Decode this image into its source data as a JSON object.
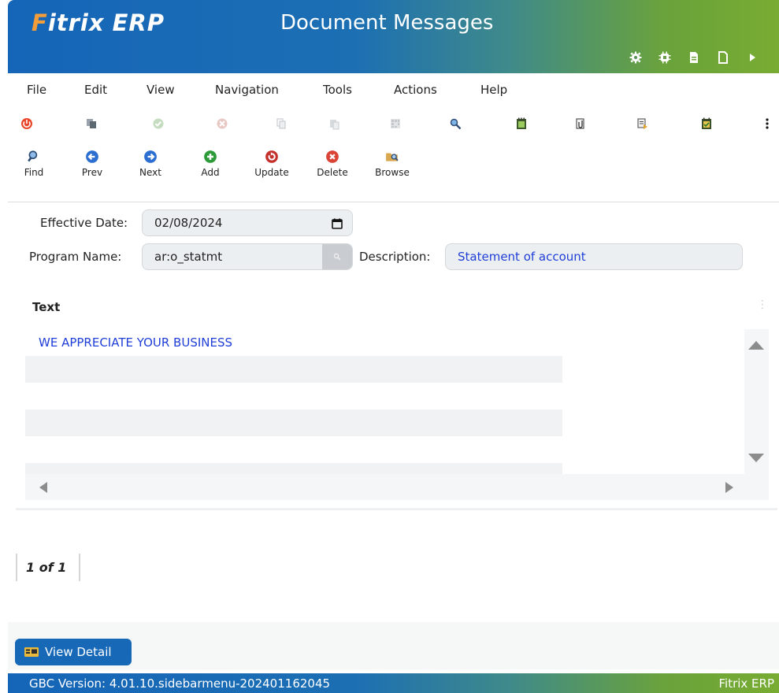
{
  "header": {
    "logo_accent": "F",
    "logo_rest": "itrix",
    "logo_erp": "ERP",
    "title": "Document Messages",
    "icons": [
      "gear-icon",
      "chip-icon",
      "document-icon",
      "new-document-icon",
      "play-icon"
    ]
  },
  "menu": [
    "File",
    "Edit",
    "View",
    "Navigation",
    "Tools",
    "Actions",
    "Help"
  ],
  "icon_toolbar": [
    "power-icon",
    "copy-icon",
    "accept-icon",
    "cancel-icon",
    "duplicate-icon",
    "paste-icon",
    "grid-icon",
    "zoom-icon",
    "notes-icon",
    "attach-icon",
    "report-icon",
    "checklist-icon",
    "more-icon"
  ],
  "actions": {
    "find": "Find",
    "prev": "Prev",
    "next": "Next",
    "add": "Add",
    "update": "Update",
    "delete": "Delete",
    "browse": "Browse"
  },
  "form": {
    "effective_date_label": "Effective Date:",
    "effective_date": "02/08/2024",
    "program_name_label": "Program Name:",
    "program_name": "ar:o_statmt",
    "description_label": "Description:",
    "description": "Statement of account"
  },
  "text_grid": {
    "title": "Text",
    "rows": [
      "WE APPRECIATE YOUR BUSINESS",
      "",
      "",
      "",
      "",
      ""
    ]
  },
  "pager": "1 of 1",
  "footer": {
    "view_detail": "View Detail",
    "version": "GBC Version: 4.01.10.sidebarmenu-202401162045",
    "brand": "Fitrix ERP"
  },
  "colors": {
    "header_blue": "#1565b8",
    "header_green": "#78ac32",
    "logo_orange": "#f39c3a",
    "value_blue": "#1f3fd8"
  }
}
